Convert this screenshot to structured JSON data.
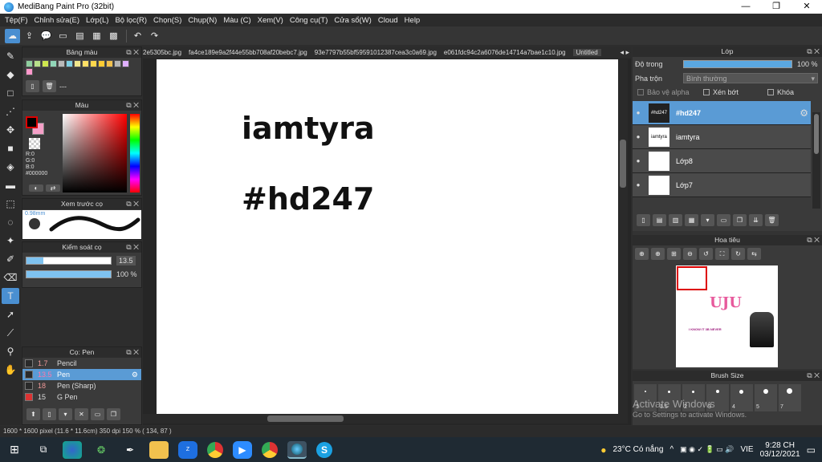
{
  "window": {
    "title": "MediBang Paint Pro (32bit)",
    "min_glyph": "—",
    "max_glyph": "❐",
    "close_glyph": "✕"
  },
  "menu": [
    "Tệp(F)",
    "Chỉnh sửa(E)",
    "Lớp(L)",
    "Bộ lọc(R)",
    "Chọn(S)",
    "Chụp(N)",
    "Màu (C)",
    "Xem(V)",
    "Công cụ(T)",
    "Cửa sổ(W)",
    "Cloud",
    "Help"
  ],
  "panels": {
    "palette": {
      "title": "Bảng màu",
      "value": "---"
    },
    "color": {
      "title": "Màu",
      "r": "R:0",
      "g": "G:0",
      "b": "B:0",
      "hex": "#000000"
    },
    "brush_preview": {
      "title": "Xem trước cọ",
      "size": "0.98mm"
    },
    "brush_control": {
      "title": "Kiểm soát cọ",
      "size_value": "13.5",
      "size_level": 0.2,
      "opacity_value": "100 %",
      "opacity_level": 1.0
    },
    "brush_list": {
      "title": "Cọ: Pen",
      "items": [
        {
          "size": "1.7",
          "name": "Pencil"
        },
        {
          "size": "13.5",
          "name": "Pen"
        },
        {
          "size": "18",
          "name": "Pen (Sharp)"
        },
        {
          "size": "15",
          "name": "G Pen"
        }
      ]
    }
  },
  "tabs": [
    "2e5305bc.jpg",
    "fa4ce189e9a2f44e55bb708af20bebc7.jpg",
    "93e7797b55bf59591012387cea3c0a69.jpg",
    "e061fdc94c2a6076de14714a7bae1c10.jpg",
    "Untitled"
  ],
  "canvas": {
    "line1": "iamtyra",
    "line2": "#hd247"
  },
  "layers": {
    "title": "Lớp",
    "opacity_label": "Độ trong",
    "opacity_value": "100 %",
    "opacity_level": 1.0,
    "blend_label": "Pha trộn",
    "blend_value": "Bình thường",
    "protect_alpha": "Bảo vệ alpha",
    "clipping": "Xén bớt",
    "lock": "Khóa",
    "items": [
      {
        "name": "#hd247",
        "thumb": "#hd247"
      },
      {
        "name": "iamtyra",
        "thumb": "iamtyra"
      },
      {
        "name": "Lớp8",
        "thumb": ""
      },
      {
        "name": "Lớp7",
        "thumb": ""
      }
    ]
  },
  "navigator": {
    "title": "Hoa tiêu",
    "art_title": "UJU",
    "art_caption": "I KNOW IT 3B NEVER"
  },
  "brush_size": {
    "title": "Brush Size",
    "numbers": [
      "1",
      "1.5",
      "2",
      "3",
      "4",
      "5",
      "7"
    ]
  },
  "watermark": {
    "line1": "Activate Windows",
    "line2": "Go to Settings to activate Windows."
  },
  "status": {
    "text": "1600 * 1600 pixel   (11.6 * 11.6cm)   350 dpi   150 %   ( 134, 87 )"
  },
  "taskbar": {
    "weather": "23°C  Có nắng",
    "lang": "VIE",
    "time": "9:28 CH",
    "date": "03/12/2021"
  }
}
